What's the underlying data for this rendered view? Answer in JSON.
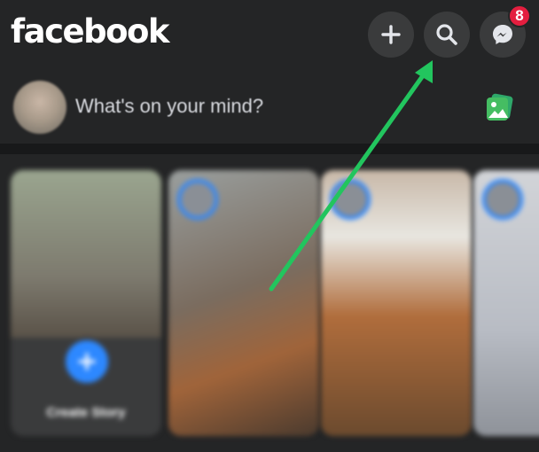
{
  "header": {
    "logo": "facebook",
    "create_icon": "plus-icon",
    "search_icon": "search-icon",
    "messenger_icon": "messenger-icon",
    "messenger_badge": "8"
  },
  "composer": {
    "placeholder": "What's on your mind?",
    "photo_icon": "photo-icon"
  },
  "stories": [
    {
      "label": "Create Story"
    },
    {
      "label": ""
    },
    {
      "label": ""
    },
    {
      "label": ""
    }
  ],
  "annotation": {
    "arrow_color": "#22c55e",
    "points_to": "search-button"
  },
  "colors": {
    "background": "#242526",
    "brand": "#ffffff",
    "accent": "#2d88ff",
    "badge": "#e41e3f"
  }
}
